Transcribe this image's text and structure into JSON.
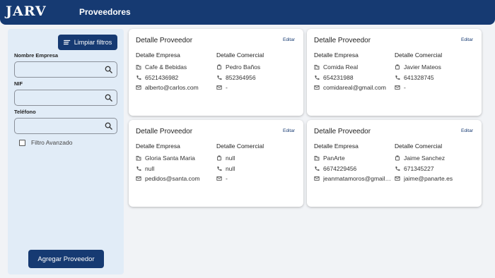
{
  "header": {
    "logo": "JARV",
    "title": "Proveedores"
  },
  "filters": {
    "clear_label": "Limpiar filtros",
    "fields": [
      {
        "label": "Nombre Empresa",
        "value": ""
      },
      {
        "label": "NIF",
        "value": ""
      },
      {
        "label": "Teléfono",
        "value": ""
      }
    ],
    "advanced_label": "Filtro Avanzado",
    "add_label": "Agregar Proveedor"
  },
  "cards": [
    {
      "title": "Detalle Proveedor",
      "edit": "Editar",
      "empresa_title": "Detalle Empresa",
      "comercial_title": "Detalle Comercial",
      "empresa": {
        "name": "Cafe & Bebidas",
        "phone": "6521436982",
        "email": "alberto@carlos.com"
      },
      "comercial": {
        "name": "Pedro Baños",
        "phone": "852364956",
        "email": "-"
      }
    },
    {
      "title": "Detalle Proveedor",
      "edit": "Editar",
      "empresa_title": "Detalle Empresa",
      "comercial_title": "Detalle Comercial",
      "empresa": {
        "name": "Comida Real",
        "phone": "654231988",
        "email": "comidareal@gmail.com"
      },
      "comercial": {
        "name": "Javier Mateos",
        "phone": "641328745",
        "email": "-"
      }
    },
    {
      "title": "Detalle Proveedor",
      "edit": "Editar",
      "empresa_title": "Detalle Empresa",
      "comercial_title": "Detalle Comercial",
      "empresa": {
        "name": "Gloria Santa Maria",
        "phone": "null",
        "email": "pedidos@santa.com"
      },
      "comercial": {
        "name": "null",
        "phone": "null",
        "email": "-"
      }
    },
    {
      "title": "Detalle Proveedor",
      "edit": "Editar",
      "empresa_title": "Detalle Empresa",
      "comercial_title": "Detalle Comercial",
      "empresa": {
        "name": "PanArte",
        "phone": "6674229456",
        "email": "jeanmatamoros@gmail.com"
      },
      "comercial": {
        "name": "Jaime Sanchez",
        "phone": "671345227",
        "email": "jaime@panarte.es"
      }
    }
  ],
  "colors": {
    "primary": "#163a72",
    "sidebar_bg": "#e1ecf7",
    "page_bg": "#f1f3f6"
  },
  "icons": {
    "search": "search-icon",
    "filter": "filter-lines-icon",
    "company": "building-icon",
    "person": "person-icon",
    "phone": "phone-icon",
    "email": "mail-icon"
  }
}
